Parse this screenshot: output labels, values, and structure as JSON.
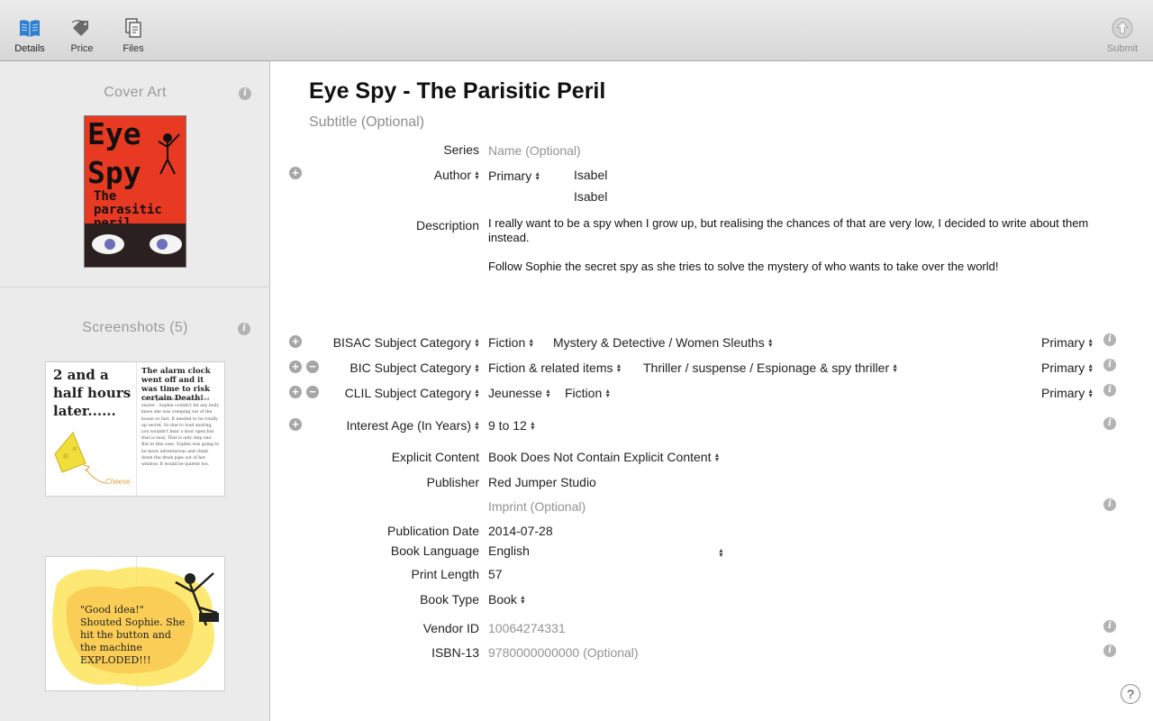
{
  "toolbar": {
    "details": "Details",
    "price": "Price",
    "files": "Files",
    "submit": "Submit"
  },
  "sidebar": {
    "cover_art_title": "Cover Art",
    "screenshots_title": "Screenshots (5)",
    "cover_text": {
      "line1": "Eye",
      "line2": "Spy",
      "line3": "The",
      "line4": "parasitic",
      "line5": "peril"
    },
    "shot1": {
      "left_text": "2 and a half hours later......",
      "right_title": "The alarm clock went off and it was time to risk certain Death!",
      "right_body": "Thank goodness Lola was a loud snorer - Sophie couldn't hit any body knew she was creeping out of the house so fast. It needed to be totally up secret. So due to loud snoring, you wouldn't hear a door open but that is easy. That is only step one. But in this case, Sophie was going to be more adventurous and climb down the drain pipe out of her window. It would be quieter too.",
      "cheese_label": "Cheese"
    },
    "shot2": {
      "text": "\"Good idea!\" Shouted Sophie. She hit the button and the machine EXPLODED!!!"
    }
  },
  "main": {
    "title": "Eye Spy - The Parisitic Peril",
    "subtitle_placeholder": "Subtitle (Optional)",
    "series_label": "Series",
    "series_placeholder": "Name (Optional)",
    "author_label": "Author",
    "author_role": "Primary",
    "author_names": [
      "Isabel",
      "Isabel"
    ],
    "description_label": "Description",
    "description_p1": "I really want to be a spy when I grow up, but realising the chances of that are very low, I decided to write about them instead.",
    "description_p2": "Follow Sophie the secret spy as she tries to solve the mystery of who wants to take over the world!",
    "bisac": {
      "label": "BISAC Subject Category",
      "cat": "Fiction",
      "sub": "Mystery & Detective / Women Sleuths",
      "rank": "Primary"
    },
    "bic": {
      "label": "BIC Subject Category",
      "cat": "Fiction & related items",
      "sub": "Thriller / suspense / Espionage & spy thriller",
      "rank": "Primary"
    },
    "clil": {
      "label": "CLIL Subject Category",
      "cat": "Jeunesse",
      "sub": "Fiction",
      "rank": "Primary"
    },
    "interest_age_label": "Interest Age (In Years)",
    "interest_age": "9 to 12",
    "explicit_label": "Explicit Content",
    "explicit_value": "Book Does Not Contain Explicit Content",
    "publisher_label": "Publisher",
    "publisher_value": "Red Jumper Studio",
    "imprint_placeholder": "Imprint (Optional)",
    "pubdate_label": "Publication Date",
    "pubdate_value": "2014-07-28",
    "language_label": "Book Language",
    "language_value": "English",
    "print_length_label": "Print Length",
    "print_length_value": "57",
    "book_type_label": "Book Type",
    "book_type_value": "Book",
    "vendor_id_label": "Vendor ID",
    "vendor_id_value": "10064274331",
    "isbn_label": "ISBN-13",
    "isbn_placeholder": "9780000000000 (Optional)",
    "help": "?"
  },
  "colors": {
    "accent": "#2f7fd1",
    "cover_red": "#e83a22",
    "placeholder": "#939393"
  },
  "icons": [
    "book-icon",
    "price-tag-icon",
    "files-icon",
    "submit-arrow-icon",
    "info-icon",
    "plus-icon",
    "minus-icon",
    "help-icon"
  ]
}
